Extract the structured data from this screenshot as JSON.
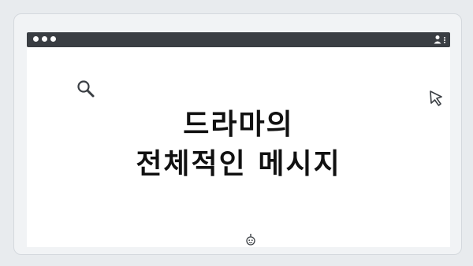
{
  "headline": {
    "line1": "드라마의",
    "line2": "전체적인 메시지"
  },
  "icons": {
    "top_dots": "pagination-dots-icon",
    "search": "search-icon",
    "cursor": "cursor-icon",
    "user": "user-icon",
    "menu": "more-vertical-icon",
    "mascot": "robot-icon"
  },
  "colors": {
    "background": "#e8ebee",
    "titlebar": "#3a3e43",
    "content": "#ffffff",
    "text": "#111111"
  }
}
